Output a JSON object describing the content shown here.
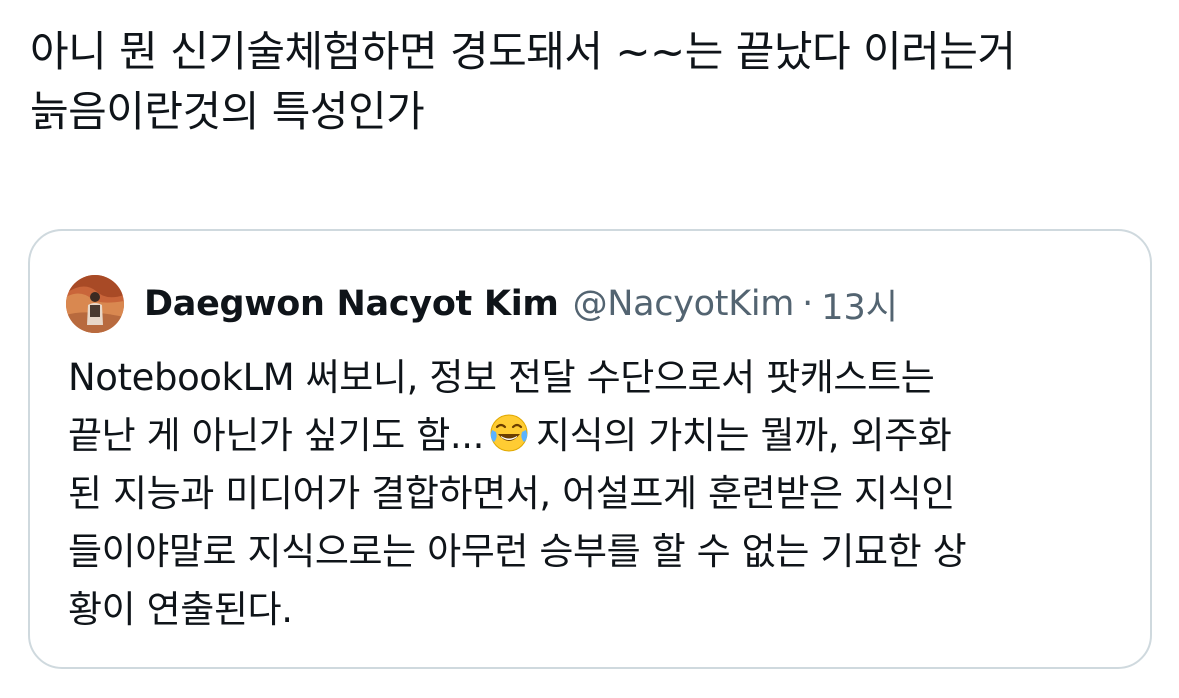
{
  "tweet": {
    "text_line1": "아니 뭔 신기술체험하면 경도돼서 ~~는 끝났다 이러는거",
    "text_line2": "늙음이란것의 특성인가"
  },
  "quote": {
    "author": {
      "display_name": "Daegwon Nacyot Kim",
      "handle": "@NacyotKim",
      "separator": "·",
      "time": "13시",
      "avatar_icon": "profile-photo"
    },
    "body": {
      "line1": "NotebookLM 써보니, 정보 전달 수단으로서 팟캐스트는",
      "line2_before_emoji": "끝난 게 아닌가 싶기도 함...",
      "emoji_name": "face-with-tears-of-joy-emoji",
      "line2_after_emoji": "지식의 가치는 뭘까, 외주화",
      "line3": "된 지능과 미디어가 결합하면서, 어설프게 훈련받은 지식인",
      "line4": "들이야말로 지식으로는 아무런 승부를 할 수 없는 기묘한 상",
      "line5": "황이 연출된다."
    }
  },
  "colors": {
    "text_primary": "#0f1419",
    "text_secondary": "#536471",
    "border": "#cfd9de",
    "background": "#ffffff"
  }
}
